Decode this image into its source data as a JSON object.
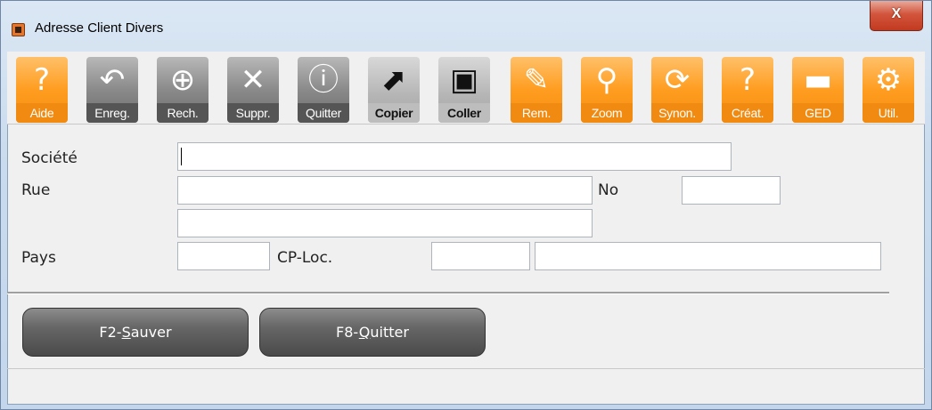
{
  "window": {
    "title": "Adresse Client Divers",
    "close_label": "X"
  },
  "toolbar": [
    {
      "name": "aide",
      "label": "Aide",
      "glyph": "?",
      "style": "orange"
    },
    {
      "name": "enreg",
      "label": "Enreg.",
      "glyph": "↶",
      "style": "gray"
    },
    {
      "name": "rech",
      "label": "Rech.",
      "glyph": "⊕",
      "style": "gray"
    },
    {
      "name": "suppr",
      "label": "Suppr.",
      "glyph": "✕",
      "style": "gray"
    },
    {
      "name": "quitter",
      "label": "Quitter",
      "glyph": "ⓘ",
      "style": "gray"
    },
    {
      "name": "copier",
      "label": "Copier",
      "glyph": "⬈",
      "style": "lgray"
    },
    {
      "name": "coller",
      "label": "Coller",
      "glyph": "▣",
      "style": "lgray"
    },
    {
      "name": "rem",
      "label": "Rem.",
      "glyph": "✎",
      "style": "orange"
    },
    {
      "name": "zoom",
      "label": "Zoom",
      "glyph": "⚲",
      "style": "orange"
    },
    {
      "name": "synon",
      "label": "Synon.",
      "glyph": "⟳",
      "style": "orange"
    },
    {
      "name": "creat",
      "label": "Créat.",
      "glyph": "?",
      "style": "orange"
    },
    {
      "name": "ged",
      "label": "GED",
      "glyph": "▬",
      "style": "orange"
    },
    {
      "name": "util",
      "label": "Util.",
      "glyph": "⚙",
      "style": "orange"
    }
  ],
  "form": {
    "societe_label": "Société",
    "societe_value": "",
    "rue_label": "Rue",
    "rue_value": "",
    "no_label": "No",
    "no_value": "",
    "rue2_value": "",
    "pays_label": "Pays",
    "pays_value": "",
    "cploc_label": "CP-Loc.",
    "cp_value": "",
    "loc_value": ""
  },
  "buttons": {
    "save_key": "F2-",
    "save_accel": "S",
    "save_rest": "auver",
    "quit_key": "F8-",
    "quit_accel": "Q",
    "quit_rest": "uitter"
  }
}
